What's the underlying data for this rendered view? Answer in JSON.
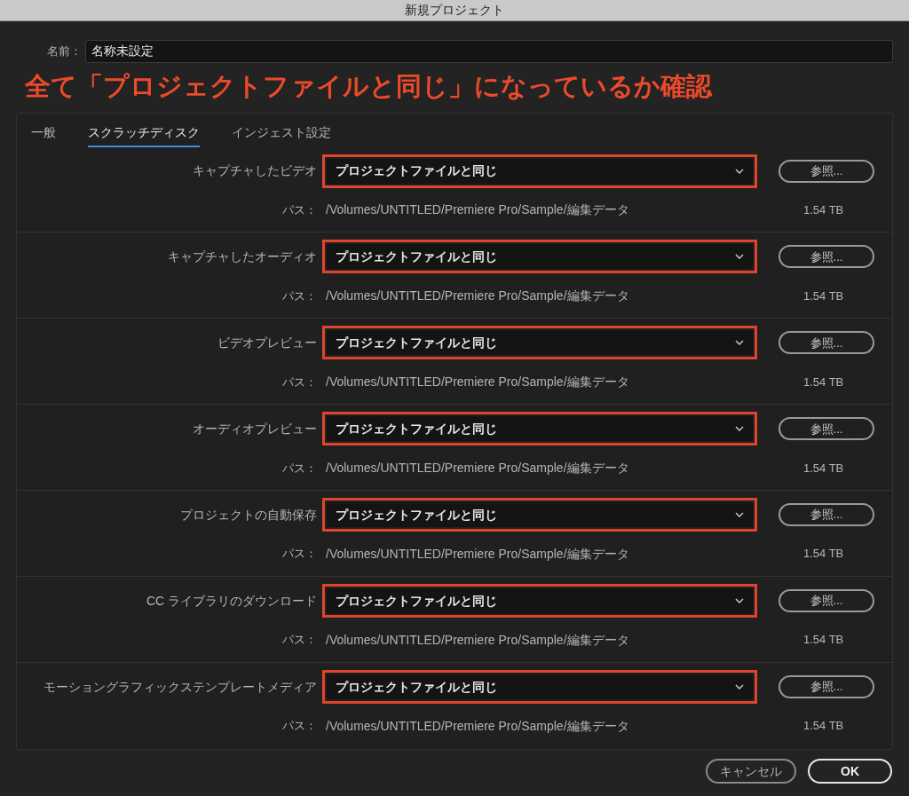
{
  "window": {
    "title": "新規プロジェクト"
  },
  "name_field": {
    "label": "名前：",
    "value": "名称未設定"
  },
  "annotation": "全て「プロジェクトファイルと同じ」になっているか確認",
  "tabs": [
    {
      "label": "一般",
      "selected": false
    },
    {
      "label": "スクラッチディスク",
      "selected": true
    },
    {
      "label": "インジェスト設定",
      "selected": false
    }
  ],
  "rows": [
    {
      "label": "キャプチャしたビデオ",
      "value": "プロジェクトファイルと同じ",
      "highlighted": true,
      "browse": "参照...",
      "path_label": "パス：",
      "path": "/Volumes/UNTITLED/Premiere Pro/Sample/編集データ",
      "size": "1.54 TB"
    },
    {
      "label": "キャプチャしたオーディオ",
      "value": "プロジェクトファイルと同じ",
      "highlighted": true,
      "browse": "参照...",
      "path_label": "パス：",
      "path": "/Volumes/UNTITLED/Premiere Pro/Sample/編集データ",
      "size": "1.54 TB"
    },
    {
      "label": "ビデオプレビュー",
      "value": "プロジェクトファイルと同じ",
      "highlighted": true,
      "browse": "参照...",
      "path_label": "パス：",
      "path": "/Volumes/UNTITLED/Premiere Pro/Sample/編集データ",
      "size": "1.54 TB"
    },
    {
      "label": "オーディオプレビュー",
      "value": "プロジェクトファイルと同じ",
      "highlighted": true,
      "browse": "参照...",
      "path_label": "パス：",
      "path": "/Volumes/UNTITLED/Premiere Pro/Sample/編集データ",
      "size": "1.54 TB"
    },
    {
      "label": "プロジェクトの自動保存",
      "value": "プロジェクトファイルと同じ",
      "highlighted": true,
      "browse": "参照...",
      "path_label": "パス：",
      "path": "/Volumes/UNTITLED/Premiere Pro/Sample/編集データ",
      "size": "1.54 TB"
    },
    {
      "label": "CC ライブラリのダウンロード",
      "value": "プロジェクトファイルと同じ",
      "highlighted": true,
      "browse": "参照...",
      "path_label": "パス：",
      "path": "/Volumes/UNTITLED/Premiere Pro/Sample/編集データ",
      "size": "1.54 TB"
    },
    {
      "label": "モーショングラフィックステンプレートメディア",
      "value": "プロジェクトファイルと同じ",
      "highlighted": true,
      "browse": "参照...",
      "path_label": "パス：",
      "path": "/Volumes/UNTITLED/Premiere Pro/Sample/編集データ",
      "size": "1.54 TB"
    }
  ],
  "buttons": [
    {
      "label": "キャンセル",
      "kind": "secondary"
    },
    {
      "label": "OK",
      "kind": "primary"
    }
  ]
}
